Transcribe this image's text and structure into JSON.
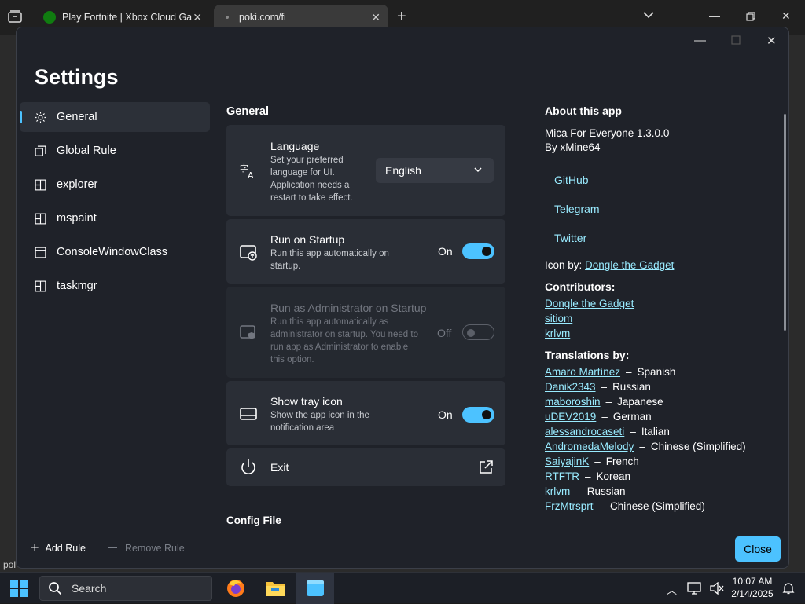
{
  "browser": {
    "tabs": [
      {
        "title": "Play Fortnite | Xbox Cloud Gaming",
        "favicon": "xbox-icon"
      },
      {
        "title": "poki.com/fi",
        "favicon": "loading-icon"
      }
    ],
    "new_tab": "+",
    "bottom_left_fragment": "pol"
  },
  "settings": {
    "title": "Settings",
    "nav": [
      {
        "label": "General",
        "icon": "gear-icon",
        "active": true
      },
      {
        "label": "Global Rule",
        "icon": "windows-stack-icon"
      },
      {
        "label": "explorer",
        "icon": "app-grid-icon"
      },
      {
        "label": "mspaint",
        "icon": "app-grid-icon"
      },
      {
        "label": "ConsoleWindowClass",
        "icon": "window-icon"
      },
      {
        "label": "taskmgr",
        "icon": "app-grid-icon"
      }
    ],
    "add_rule": "Add Rule",
    "remove_rule": "Remove Rule",
    "section_title": "General",
    "language": {
      "title": "Language",
      "desc": "Set your preferred language for UI. Application needs a restart to take effect.",
      "value": "English"
    },
    "startup": {
      "title": "Run on Startup",
      "desc": "Run this app automatically on startup.",
      "state": "On"
    },
    "admin": {
      "title": "Run as Administrator on Startup",
      "desc": "Run this app automatically as administrator on startup. You need to run app as Administrator to enable this option.",
      "state": "Off"
    },
    "tray": {
      "title": "Show tray icon",
      "desc": "Show the app icon in the notification area",
      "state": "On"
    },
    "exit": {
      "title": "Exit"
    },
    "config_title": "Config File",
    "about": {
      "title": "About this app",
      "version": "Mica For Everyone 1.3.0.0",
      "author": "By xMine64",
      "links": [
        "GitHub",
        "Telegram",
        "Twitter"
      ],
      "icon_by_label": "Icon by:",
      "icon_by_name": "Dongle the Gadget",
      "contributors_title": "Contributors:",
      "contributors": [
        "Dongle the Gadget",
        "sitiom",
        "krlvm"
      ],
      "translations_title": "Translations by:",
      "translations": [
        {
          "name": "Amaro Martínez",
          "lang": "Spanish"
        },
        {
          "name": "Danik2343",
          "lang": "Russian"
        },
        {
          "name": "maboroshin",
          "lang": "Japanese"
        },
        {
          "name": "uDEV2019",
          "lang": "German"
        },
        {
          "name": "alessandrocaseti",
          "lang": "Italian"
        },
        {
          "name": "AndromedaMelody",
          "lang": "Chinese (Simplified)"
        },
        {
          "name": "SaiyajinK",
          "lang": "French"
        },
        {
          "name": "RTFTR",
          "lang": "Korean"
        },
        {
          "name": "krlvm",
          "lang": "Russian"
        },
        {
          "name": "FrzMtrsprt",
          "lang": "Chinese (Simplified)"
        }
      ],
      "separator": "–"
    },
    "close": "Close"
  },
  "taskbar": {
    "search": "Search",
    "time": "10:07 AM",
    "date": "2/14/2025"
  },
  "colors": {
    "accent": "#4cc2ff",
    "link": "#99ebff"
  }
}
